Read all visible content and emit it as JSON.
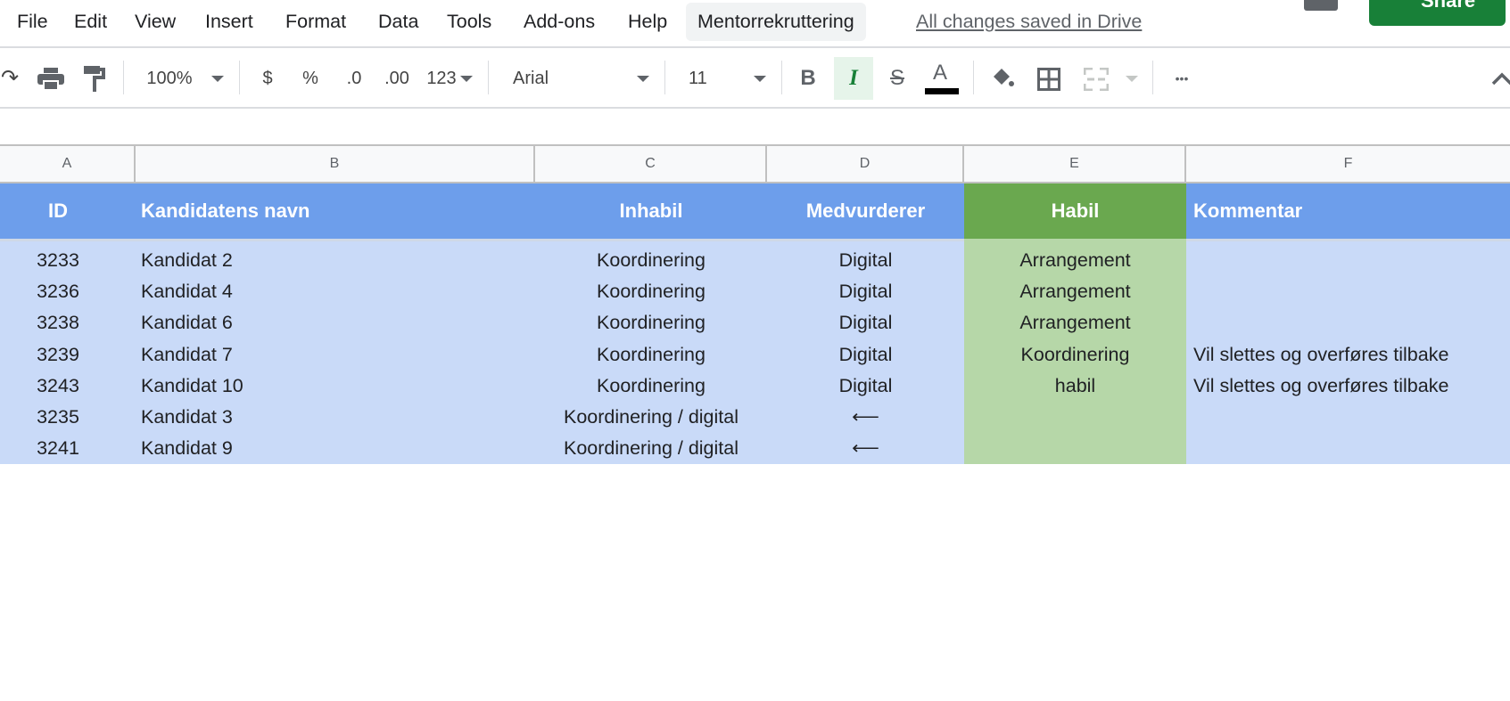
{
  "menu": {
    "items": [
      "File",
      "Edit",
      "View",
      "Insert",
      "Format",
      "Data",
      "Tools",
      "Add-ons",
      "Help"
    ],
    "custom_menu": "Mentorrekruttering",
    "save_status": "All changes saved in Drive",
    "share_label": "Share"
  },
  "toolbar": {
    "zoom": "100%",
    "currency": "$",
    "percent": "%",
    "decrease_decimals": ".0",
    "increase_decimals": ".00",
    "more_formats": "123",
    "font": "Arial",
    "font_size": "11",
    "bold": "B",
    "italic": "I",
    "strikethrough": "S",
    "text_color": "A",
    "more": "•••",
    "text_color_value": "#000000"
  },
  "columns": [
    "A",
    "B",
    "C",
    "D",
    "E",
    "F"
  ],
  "header": [
    "ID",
    "Kandidatens navn",
    "Inhabil",
    "Medvurderer",
    "Habil",
    "Kommentar"
  ],
  "rows": [
    [
      "3233",
      "Kandidat 2",
      "Koordinering",
      "Digital",
      "Arrangement",
      ""
    ],
    [
      "3236",
      "Kandidat 4",
      "Koordinering",
      "Digital",
      "Arrangement",
      ""
    ],
    [
      "3238",
      "Kandidat 6",
      "Koordinering",
      "Digital",
      "Arrangement",
      ""
    ],
    [
      "3239",
      "Kandidat 7",
      "Koordinering",
      "Digital",
      "Koordinering",
      "Vil slettes og overføres tilbake"
    ],
    [
      "3243",
      "Kandidat 10",
      "Koordinering",
      "Digital",
      "habil",
      "Vil slettes og overføres tilbake"
    ],
    [
      "3235",
      "Kandidat 3",
      "Koordinering / digital",
      "⟵",
      "",
      ""
    ],
    [
      "3241",
      "Kandidat 9",
      "Koordinering / digital",
      "⟵",
      "",
      ""
    ]
  ],
  "colors": {
    "header_blue": "#6d9eeb",
    "header_green": "#6aa84f",
    "row_blue": "#c9daf8",
    "row_green": "#b6d7a8",
    "share": "#188038"
  }
}
